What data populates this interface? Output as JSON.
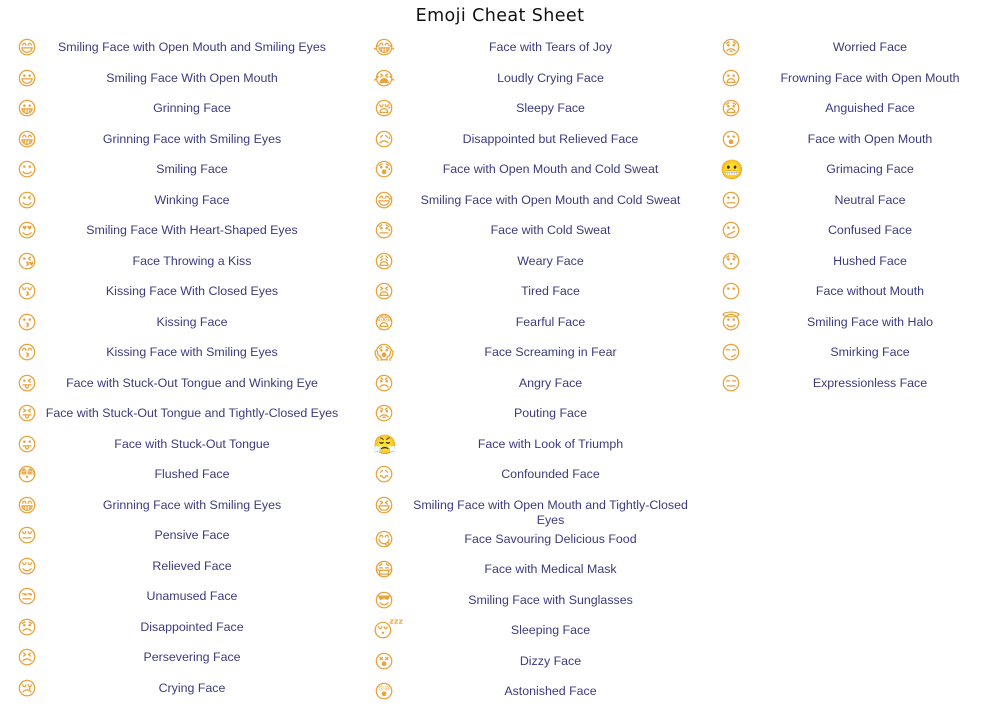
{
  "page": {
    "title": "Emoji Cheat Sheet",
    "text_color": "#3b3b7d",
    "title_color": "#111111",
    "background_color": "#ffffff"
  },
  "columns": [
    {
      "id": "column-1",
      "rows": [
        {
          "glyph": "😄",
          "icon_name": "smiling-face-open-mouth-smiling-eyes-icon",
          "label": "Smiling Face with Open Mouth and Smiling Eyes"
        },
        {
          "glyph": "😃",
          "icon_name": "smiling-face-open-mouth-icon",
          "label": "Smiling Face With Open Mouth"
        },
        {
          "glyph": "😀",
          "icon_name": "grinning-face-icon",
          "label": "Grinning Face"
        },
        {
          "glyph": "😁",
          "icon_name": "grinning-face-smiling-eyes-icon",
          "label": "Grinning Face with Smiling Eyes"
        },
        {
          "glyph": "☺",
          "icon_name": "smiling-face-icon",
          "label": "Smiling Face"
        },
        {
          "glyph": "😉",
          "icon_name": "winking-face-icon",
          "label": "Winking Face"
        },
        {
          "glyph": "😍",
          "icon_name": "smiling-face-heart-shaped-eyes-icon",
          "label": "Smiling Face With Heart-Shaped Eyes"
        },
        {
          "glyph": "😘",
          "icon_name": "face-throwing-a-kiss-icon",
          "label": "Face Throwing a Kiss"
        },
        {
          "glyph": "😚",
          "icon_name": "kissing-face-closed-eyes-icon",
          "label": "Kissing Face With Closed Eyes"
        },
        {
          "glyph": "😗",
          "icon_name": "kissing-face-icon",
          "label": "Kissing Face"
        },
        {
          "glyph": "😙",
          "icon_name": "kissing-face-smiling-eyes-icon",
          "label": "Kissing Face with Smiling Eyes"
        },
        {
          "glyph": "😜",
          "icon_name": "face-stuck-out-tongue-winking-eye-icon",
          "label": "Face with Stuck-Out Tongue and Winking Eye"
        },
        {
          "glyph": "😝",
          "icon_name": "face-stuck-out-tongue-tightly-closed-eyes-icon",
          "label": "Face with Stuck-Out Tongue and Tightly-Closed Eyes"
        },
        {
          "glyph": "😛",
          "icon_name": "face-stuck-out-tongue-icon",
          "label": "Face with Stuck-Out Tongue"
        },
        {
          "glyph": "😳",
          "icon_name": "flushed-face-icon",
          "label": "Flushed Face"
        },
        {
          "glyph": "😁",
          "icon_name": "grinning-face-smiling-eyes-icon",
          "label": "Grinning Face with Smiling Eyes"
        },
        {
          "glyph": "😔",
          "icon_name": "pensive-face-icon",
          "label": "Pensive Face"
        },
        {
          "glyph": "😌",
          "icon_name": "relieved-face-icon",
          "label": "Relieved Face"
        },
        {
          "glyph": "😒",
          "icon_name": "unamused-face-icon",
          "label": "Unamused Face"
        },
        {
          "glyph": "😞",
          "icon_name": "disappointed-face-icon",
          "label": "Disappointed Face"
        },
        {
          "glyph": "😣",
          "icon_name": "persevering-face-icon",
          "label": "Persevering Face"
        },
        {
          "glyph": "😢",
          "icon_name": "crying-face-icon",
          "label": "Crying Face"
        }
      ]
    },
    {
      "id": "column-2",
      "rows": [
        {
          "glyph": "😂",
          "icon_name": "face-with-tears-of-joy-icon",
          "label": "Face with Tears of Joy"
        },
        {
          "glyph": "😭",
          "icon_name": "loudly-crying-face-icon",
          "label": "Loudly Crying Face"
        },
        {
          "glyph": "😪",
          "icon_name": "sleepy-face-icon",
          "label": "Sleepy Face"
        },
        {
          "glyph": "😥",
          "icon_name": "disappointed-but-relieved-face-icon",
          "label": "Disappointed but Relieved Face"
        },
        {
          "glyph": "😰",
          "icon_name": "face-open-mouth-cold-sweat-icon",
          "label": "Face with Open Mouth and Cold Sweat"
        },
        {
          "glyph": "😅",
          "icon_name": "smiling-face-open-mouth-cold-sweat-icon",
          "label": "Smiling Face with Open Mouth and Cold Sweat"
        },
        {
          "glyph": "😓",
          "icon_name": "face-with-cold-sweat-icon",
          "label": "Face with Cold Sweat"
        },
        {
          "glyph": "😩",
          "icon_name": "weary-face-icon",
          "label": "Weary Face"
        },
        {
          "glyph": "😫",
          "icon_name": "tired-face-icon",
          "label": "Tired Face"
        },
        {
          "glyph": "😨",
          "icon_name": "fearful-face-icon",
          "label": "Fearful Face"
        },
        {
          "glyph": "😱",
          "icon_name": "face-screaming-in-fear-icon",
          "label": "Face Screaming in Fear"
        },
        {
          "glyph": "😠",
          "icon_name": "angry-face-icon",
          "label": "Angry Face"
        },
        {
          "glyph": "😡",
          "icon_name": "pouting-face-icon",
          "label": "Pouting Face"
        },
        {
          "glyph": "😤",
          "icon_name": "face-with-look-of-triumph-icon",
          "label": "Face with Look of Triumph"
        },
        {
          "glyph": "😖",
          "icon_name": "confounded-face-icon",
          "label": "Confounded Face"
        },
        {
          "glyph": "😆",
          "icon_name": "smiling-face-open-mouth-tightly-closed-eyes-icon",
          "label": "Smiling Face with Open Mouth and Tightly-Closed Eyes"
        },
        {
          "glyph": "😋",
          "icon_name": "face-savouring-delicious-food-icon",
          "label": "Face Savouring Delicious Food"
        },
        {
          "glyph": "😷",
          "icon_name": "face-with-medical-mask-icon",
          "label": "Face with Medical Mask"
        },
        {
          "glyph": "😎",
          "icon_name": "smiling-face-with-sunglasses-icon",
          "label": "Smiling Face with Sunglasses"
        },
        {
          "glyph": "😴",
          "icon_name": "sleeping-face-icon",
          "label": "Sleeping Face"
        },
        {
          "glyph": "😵",
          "icon_name": "dizzy-face-icon",
          "label": "Dizzy Face"
        },
        {
          "glyph": "😲",
          "icon_name": "astonished-face-icon",
          "label": "Astonished Face"
        }
      ]
    },
    {
      "id": "column-3",
      "rows": [
        {
          "glyph": "😟",
          "icon_name": "worried-face-icon",
          "label": "Worried Face"
        },
        {
          "glyph": "😦",
          "icon_name": "frowning-face-with-open-mouth-icon",
          "label": "Frowning Face with Open Mouth"
        },
        {
          "glyph": "😧",
          "icon_name": "anguished-face-icon",
          "label": "Anguished Face"
        },
        {
          "glyph": "😮",
          "icon_name": "face-with-open-mouth-icon",
          "label": "Face with Open Mouth"
        },
        {
          "glyph": "😬",
          "icon_name": "grimacing-face-icon",
          "label": "Grimacing Face"
        },
        {
          "glyph": "😐",
          "icon_name": "neutral-face-icon",
          "label": "Neutral Face"
        },
        {
          "glyph": "😕",
          "icon_name": "confused-face-icon",
          "label": "Confused Face"
        },
        {
          "glyph": "😯",
          "icon_name": "hushed-face-icon",
          "label": "Hushed Face"
        },
        {
          "glyph": "😶",
          "icon_name": "face-without-mouth-icon",
          "label": "Face without Mouth"
        },
        {
          "glyph": "😇",
          "icon_name": "smiling-face-with-halo-icon",
          "label": "Smiling Face with Halo"
        },
        {
          "glyph": "😏",
          "icon_name": "smirking-face-icon",
          "label": "Smirking Face"
        },
        {
          "glyph": "😑",
          "icon_name": "expressionless-face-icon",
          "label": "Expressionless Face"
        }
      ]
    }
  ]
}
